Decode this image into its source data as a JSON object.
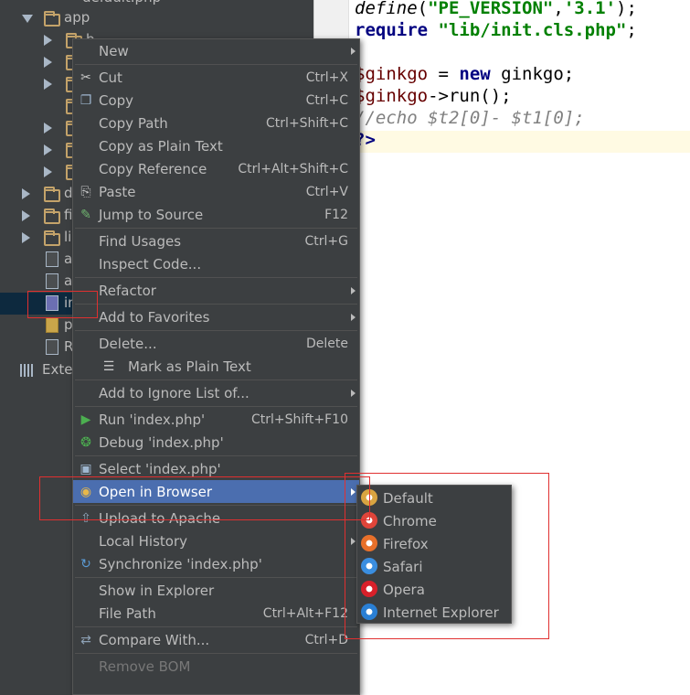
{
  "tree": {
    "top_partial": "default.php",
    "items": [
      {
        "label": "app",
        "kind": "folder",
        "arrow": "down"
      },
      {
        "label": "b",
        "kind": "folder",
        "arrow": "right"
      },
      {
        "label": "",
        "kind": "folder",
        "arrow": "right"
      },
      {
        "label": "",
        "kind": "folder",
        "arrow": "right"
      },
      {
        "label": "",
        "kind": "folder",
        "arrow": "none"
      },
      {
        "label": "",
        "kind": "folder",
        "arrow": "right"
      },
      {
        "label": "",
        "kind": "folder",
        "arrow": "right"
      },
      {
        "label": "",
        "kind": "folder",
        "arrow": "right"
      },
      {
        "label": "d",
        "kind": "folder",
        "arrow": "right"
      },
      {
        "label": "fi",
        "kind": "folder",
        "arrow": "right"
      },
      {
        "label": "li",
        "kind": "folder",
        "arrow": "right"
      },
      {
        "label": "a",
        "kind": "file",
        "arrow": "none"
      },
      {
        "label": "a",
        "kind": "file",
        "arrow": "none"
      },
      {
        "label": "in",
        "kind": "php",
        "arrow": "none"
      },
      {
        "label": "p",
        "kind": "sql",
        "arrow": "none"
      },
      {
        "label": "R",
        "kind": "file",
        "arrow": "none"
      }
    ],
    "external": "Exter"
  },
  "editor": {
    "lines": [
      {
        "tokens": [
          {
            "t": "define",
            "c": "fn"
          },
          {
            "t": "(",
            "c": ""
          },
          {
            "t": "\"PE_VERSION\"",
            "c": "str"
          },
          {
            "t": ",",
            "c": ""
          },
          {
            "t": "'3.1'",
            "c": "str"
          },
          {
            "t": ");",
            "c": ""
          }
        ]
      },
      {
        "tokens": [
          {
            "t": "require ",
            "c": "kw"
          },
          {
            "t": "\"lib/init.cls.php\"",
            "c": "str"
          },
          {
            "t": ";",
            "c": ""
          }
        ]
      },
      {
        "tokens": []
      },
      {
        "tokens": [
          {
            "t": "$ginkgo",
            "c": "var"
          },
          {
            "t": " = ",
            "c": ""
          },
          {
            "t": "new ",
            "c": "kw"
          },
          {
            "t": "ginkgo;",
            "c": ""
          }
        ]
      },
      {
        "tokens": [
          {
            "t": "$ginkgo",
            "c": "var"
          },
          {
            "t": "->run();",
            "c": ""
          }
        ]
      },
      {
        "tokens": [
          {
            "t": "//echo $t2[0]- $t1[0];",
            "c": "cm"
          }
        ]
      },
      {
        "tokens": [
          {
            "t": "?>",
            "c": "kw"
          }
        ]
      }
    ]
  },
  "menu": {
    "items": [
      {
        "label": "New",
        "shortcut": "",
        "icon": "",
        "submenu": true
      },
      {
        "sep": true
      },
      {
        "label": "Cut",
        "shortcut": "Ctrl+X",
        "icon": "scissors-icon"
      },
      {
        "label": "Copy",
        "shortcut": "Ctrl+C",
        "icon": "copy-icon"
      },
      {
        "label": "Copy Path",
        "shortcut": "Ctrl+Shift+C",
        "icon": ""
      },
      {
        "label": "Copy as Plain Text",
        "shortcut": "",
        "icon": ""
      },
      {
        "label": "Copy Reference",
        "shortcut": "Ctrl+Alt+Shift+C",
        "icon": ""
      },
      {
        "label": "Paste",
        "shortcut": "Ctrl+V",
        "icon": "paste-icon"
      },
      {
        "label": "Jump to Source",
        "shortcut": "F12",
        "icon": "jump-icon"
      },
      {
        "sep": true
      },
      {
        "label": "Find Usages",
        "shortcut": "Ctrl+G",
        "icon": ""
      },
      {
        "label": "Inspect Code...",
        "shortcut": "",
        "icon": ""
      },
      {
        "sep": true
      },
      {
        "label": "Refactor",
        "shortcut": "",
        "icon": "",
        "submenu": true
      },
      {
        "sep": true
      },
      {
        "label": "Add to Favorites",
        "shortcut": "",
        "icon": "",
        "submenu": true
      },
      {
        "sep": true
      },
      {
        "label": "Delete...",
        "shortcut": "Delete",
        "icon": ""
      },
      {
        "label": "Mark as Plain Text",
        "shortcut": "",
        "icon": "document-icon",
        "indent": true
      },
      {
        "sep": true
      },
      {
        "label": "Add to Ignore List of...",
        "shortcut": "",
        "icon": "",
        "submenu": true
      },
      {
        "sep": true
      },
      {
        "label": "Run 'index.php'",
        "shortcut": "Ctrl+Shift+F10",
        "icon": "run-icon"
      },
      {
        "label": "Debug 'index.php'",
        "shortcut": "",
        "icon": "debug-icon"
      },
      {
        "sep": true
      },
      {
        "label": "Select 'index.php'",
        "shortcut": "",
        "icon": "select-icon"
      },
      {
        "label": "Open in Browser",
        "shortcut": "",
        "icon": "browser-icon",
        "submenu": true,
        "highlight": true
      },
      {
        "sep": true
      },
      {
        "label": "Upload to Apache",
        "shortcut": "",
        "icon": "upload-icon"
      },
      {
        "label": "Local History",
        "shortcut": "",
        "icon": "",
        "submenu": true
      },
      {
        "label": "Synchronize 'index.php'",
        "shortcut": "",
        "icon": "sync-icon"
      },
      {
        "sep": true
      },
      {
        "label": "Show in Explorer",
        "shortcut": "",
        "icon": ""
      },
      {
        "label": "File Path",
        "shortcut": "Ctrl+Alt+F12",
        "icon": ""
      },
      {
        "sep": true
      },
      {
        "label": "Compare With...",
        "shortcut": "Ctrl+D",
        "icon": "compare-icon"
      },
      {
        "sep": true
      },
      {
        "label": "Remove BOM",
        "shortcut": "",
        "icon": "",
        "disabled": true
      }
    ]
  },
  "submenu": {
    "items": [
      {
        "label": "Default",
        "icon": "default-browser-icon",
        "color": "#d9a441"
      },
      {
        "label": "Chrome",
        "icon": "chrome-icon",
        "color": "#e0453a"
      },
      {
        "label": "Firefox",
        "icon": "firefox-icon",
        "color": "#e8702a"
      },
      {
        "label": "Safari",
        "icon": "safari-icon",
        "color": "#3a8ee0"
      },
      {
        "label": "Opera",
        "icon": "opera-icon",
        "color": "#d8202a"
      },
      {
        "label": "Internet Explorer",
        "icon": "ie-icon",
        "color": "#2a7fd4"
      }
    ]
  }
}
